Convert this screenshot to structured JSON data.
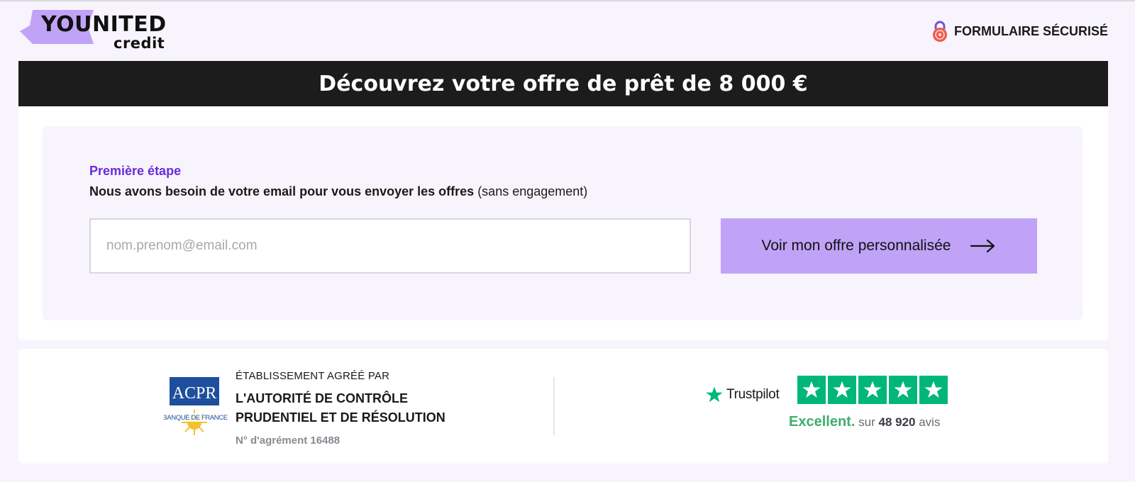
{
  "header": {
    "logo_word": "YOUNITED",
    "logo_sub": "credit",
    "secure_label": "FORMULAIRE SÉCURISÉ"
  },
  "banner": {
    "title": "Découvrez votre offre de prêt de 8 000 €"
  },
  "form": {
    "step_label": "Première étape",
    "description_bold": "Nous avons besoin de votre email pour vous envoyer les offres",
    "description_rest": "(sans engagement)",
    "email_placeholder": "nom.prenom@email.com",
    "email_value": "",
    "cta_label": "Voir mon offre personnalisée"
  },
  "trust": {
    "acpr": {
      "logo_text": "ACPR",
      "logo_sub": "BANQUE DE FRANCE",
      "pre_label": "ÉTABLISSEMENT AGRÉÉ PAR",
      "name_line1": "L'AUTORITÉ DE CONTRÔLE",
      "name_line2": "PRUDENTIEL ET DE RÉSOLUTION",
      "agreement": "N° d'agrément 16488"
    },
    "trustpilot": {
      "brand": "Trustpilot",
      "rating_word": "Excellent.",
      "sur": "sur",
      "count": "48 920",
      "avis": "avis",
      "stars": 5
    }
  },
  "colors": {
    "accent_purple": "#6b2bd9",
    "cta_bg": "#c0a3f7",
    "banner_bg": "#1c1c1c",
    "trustpilot_green": "#00b67a",
    "page_bg": "#f7f4fd"
  },
  "icons": {
    "secure": "padlock-icon",
    "cta": "arrow-right-icon",
    "tp_brand": "star-icon"
  }
}
